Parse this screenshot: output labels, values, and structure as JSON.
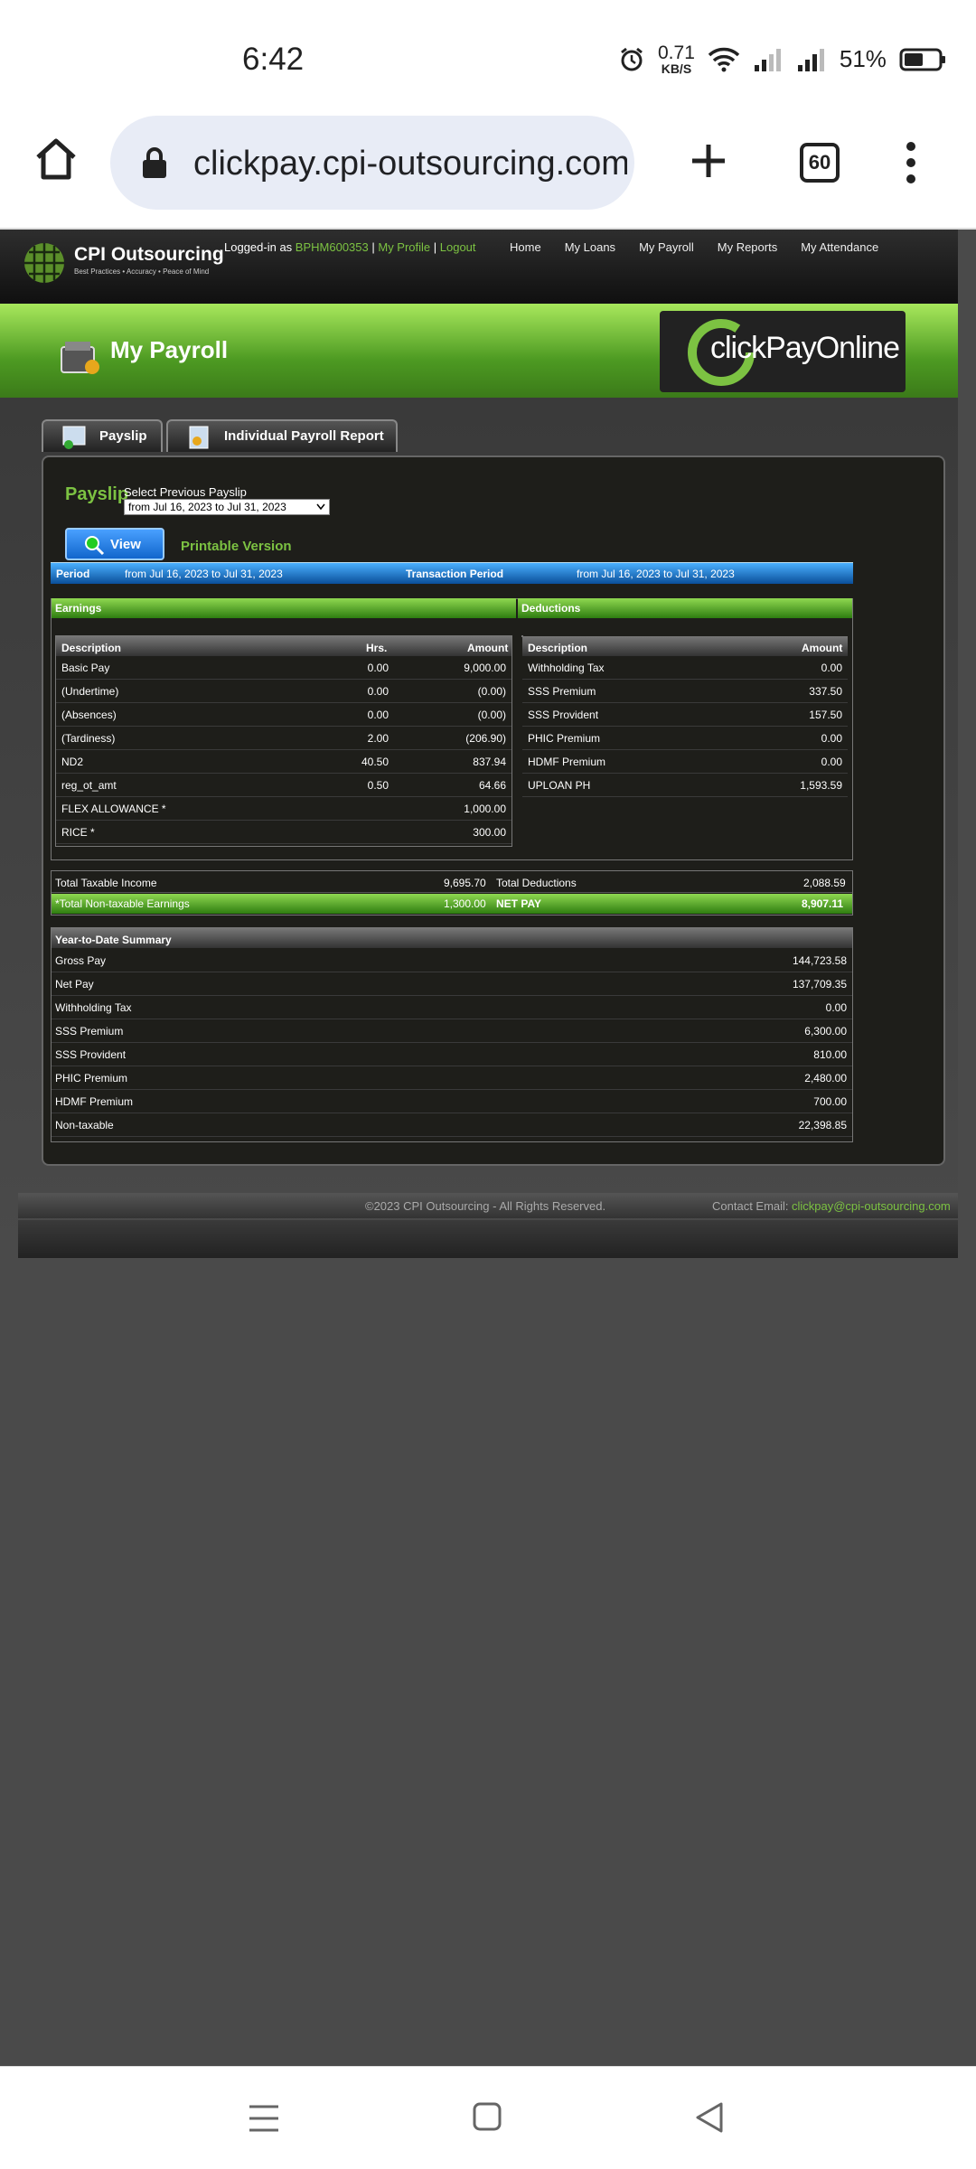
{
  "status": {
    "time": "6:42",
    "net_speed": "0.71",
    "net_unit": "KB/S",
    "battery": "51%"
  },
  "browser": {
    "url": "clickpay.cpi-outsourcing.com",
    "tab_count": "60"
  },
  "site": {
    "logo_name": "CPI Outsourcing",
    "logo_tagline": "Best Practices • Accuracy • Peace of Mind",
    "logged_in_prefix": "Logged-in as",
    "user_id": "BPHM600353",
    "my_profile": "My Profile",
    "logout": "Logout",
    "menu": [
      "Home",
      "My Loans",
      "My Payroll",
      "My Reports",
      "My Attendance"
    ],
    "page_title": "My Payroll",
    "brand_logo": "clickPayOnline",
    "tabs": [
      "Payslip",
      "Individual Payroll Report"
    ]
  },
  "payslip": {
    "title": "Payslip",
    "select_label": "Select Previous Payslip",
    "selected_period": "from Jul 16, 2023 to Jul 31, 2023",
    "view_button": "View",
    "printable": "Printable Version",
    "period_label": "Period",
    "period_value": "from Jul 16, 2023 to Jul 31, 2023",
    "transaction_label": "Transaction Period",
    "transaction_value": "from Jul 16, 2023 to Jul 31, 2023",
    "earnings_title": "Earnings",
    "deductions_title": "Deductions",
    "earn_headers": [
      "Description",
      "Hrs.",
      "Amount"
    ],
    "earnings": [
      [
        "Basic Pay",
        "0.00",
        "9,000.00"
      ],
      [
        "(Undertime)",
        "0.00",
        "(0.00)"
      ],
      [
        "(Absences)",
        "0.00",
        "(0.00)"
      ],
      [
        "(Tardiness)",
        "2.00",
        "(206.90)"
      ],
      [
        "ND2",
        "40.50",
        "837.94"
      ],
      [
        "reg_ot_amt",
        "0.50",
        "64.66"
      ],
      [
        "FLEX ALLOWANCE *",
        "",
        "1,000.00"
      ],
      [
        "RICE *",
        "",
        "300.00"
      ]
    ],
    "ded_headers": [
      "Description",
      "Amount"
    ],
    "deductions": [
      [
        "Withholding Tax",
        "0.00"
      ],
      [
        "SSS Premium",
        "337.50"
      ],
      [
        "SSS Provident",
        "157.50"
      ],
      [
        "PHIC Premium",
        "0.00"
      ],
      [
        "HDMF Premium",
        "0.00"
      ],
      [
        "UPLOAN PH",
        "1,593.59"
      ]
    ],
    "total_taxable_label": "Total Taxable Income",
    "total_taxable": "9,695.70",
    "total_deductions_label": "Total Deductions",
    "total_deductions": "2,088.59",
    "non_taxable_label": "*Total Non-taxable Earnings",
    "non_taxable": "1,300.00",
    "net_pay_label": "NET PAY",
    "net_pay": "8,907.11",
    "ytd_title": "Year-to-Date Summary",
    "ytd": [
      [
        "Gross Pay",
        "144,723.58"
      ],
      [
        "Net Pay",
        "137,709.35"
      ],
      [
        "Withholding Tax",
        "0.00"
      ],
      [
        "SSS Premium",
        "6,300.00"
      ],
      [
        "SSS Provident",
        "810.00"
      ],
      [
        "PHIC Premium",
        "2,480.00"
      ],
      [
        "HDMF Premium",
        "700.00"
      ],
      [
        "Non-taxable",
        "22,398.85"
      ]
    ]
  },
  "footer": {
    "copyright": "©2023 CPI Outsourcing - All Rights Reserved.",
    "contact_label": "Contact Email:",
    "contact_email": "clickpay@cpi-outsourcing.com"
  }
}
